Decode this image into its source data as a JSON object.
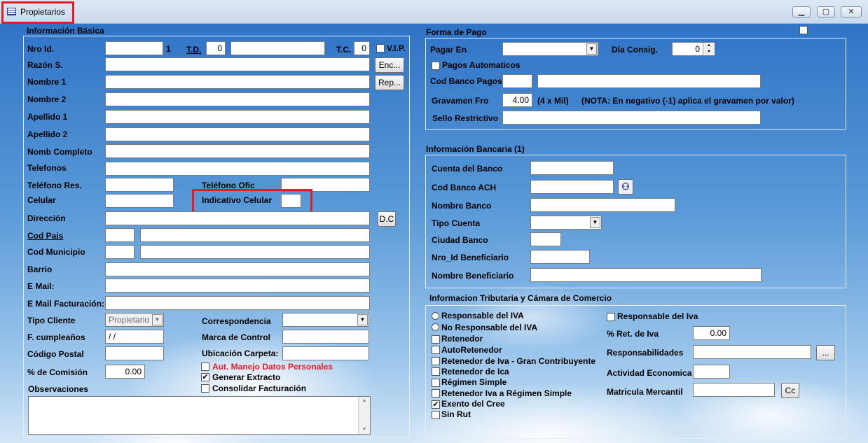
{
  "window": {
    "title": "Propietarios",
    "min": "▁",
    "max": "▢",
    "close": "✕"
  },
  "basic": {
    "title": "Información Básica",
    "nro_id": {
      "label": "Nro Id.",
      "value": "",
      "suffix": "1"
    },
    "td": {
      "label": "T.D.",
      "value": "0"
    },
    "tc": {
      "label": "T.C.",
      "value": "0"
    },
    "vip": "V.I.P.",
    "razon": "Razón S.",
    "btn_enc": "Enc...",
    "btn_rep": "Rep...",
    "nombre1": "Nombre 1",
    "nombre2": "Nombre 2",
    "apellido1": "Apellido 1",
    "apellido2": "Apellido 2",
    "nomb_completo": "Nomb Completo",
    "telefonos": "Telefonos",
    "tel_res": "Teléfono Res.",
    "tel_ofic": "Teléfono Ofic",
    "celular": "Celular",
    "ind_celular": "Indicativo Celular",
    "direccion": "Dirección",
    "btn_dc": "D.C",
    "cod_pais": "Cod Pais",
    "cod_municipio": "Cod Municipio",
    "barrio": "Barrio",
    "email": "E Mail:",
    "email_fact": "E Mail Facturación:",
    "tipo_cliente": {
      "label": "Tipo Cliente",
      "value": "Propietario"
    },
    "correspondencia": "Correspondencia",
    "f_cumple": {
      "label": "F. cumpleaños",
      "value": " / /"
    },
    "marca_control": "Marca de Control",
    "cod_postal": "Código Postal",
    "ubicacion": "Ubicación Carpeta:",
    "comision": {
      "label": "% de Comisión",
      "value": "0.00"
    },
    "aut_datos": "Aut. Manejo Datos Personales",
    "gen_extracto": "Generar Extracto",
    "consolidar": "Consolidar Facturación",
    "observaciones": "Observaciones",
    "checked_mark": "✔"
  },
  "pago": {
    "title": "Forma de Pago",
    "pagar_en": "Pagar En",
    "dia_consig": {
      "label": "Día Consig.",
      "value": "0"
    },
    "pagos_auto": "Pagos Automaticos",
    "cod_banco_pagos": "Cod Banco Pagos",
    "gravamen": {
      "label": "Gravamen Fro",
      "value": "4.00",
      "unit": "(4 x Mil)",
      "nota": "(NOTA: En negativo (-1) aplica el gravamen por valor)"
    },
    "sello": "Sello Restrictivo"
  },
  "banco": {
    "title": "Información Bancaria (1)",
    "cuenta": "Cuenta del Banco",
    "ach": "Cod Banco ACH",
    "nombre": "Nombre Banco",
    "tipo": "Tipo Cuenta",
    "ciudad": "Ciudad Banco",
    "nro_benef": "Nro_Id Beneficiario",
    "nom_benef": "Nombre Beneficiario"
  },
  "tributaria": {
    "title": "Informacion Tributaria y Cámara de Comercio",
    "resp_iva_r": "Responsable del IVA",
    "no_resp_iva": "No Responsable del IVA",
    "retenedor": "Retenedor",
    "autoretenedor": "AutoRetenedor",
    "ret_gran": "Retenedor de Iva - Gran Contribuyente",
    "ret_ica": "Retenedor de Ica",
    "regimen": "Régimen Simple",
    "ret_iva_reg": "Retenedor Iva a Régimen Simple",
    "exento": "Exento del Cree",
    "sin_rut": "Sin Rut",
    "resp_iva_c": "Responsable del Iva",
    "ret_iva": {
      "label": "% Ret. de Iva",
      "value": "0.00"
    },
    "responsabilidades": "Responsabilidades",
    "btn_dots": "...",
    "actividad": "Actividad Economica",
    "matricula": "Matricula Mercantil",
    "btn_cc": "Cc"
  }
}
